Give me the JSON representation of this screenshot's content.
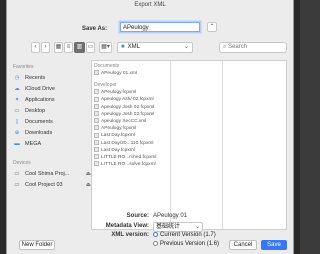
{
  "window": {
    "title": "Export XML"
  },
  "save_as": {
    "label": "Save As:",
    "value": "APeulogy",
    "expand_icon": "chevron-up-icon"
  },
  "toolbar": {
    "location": "XML",
    "search_placeholder": "Search",
    "back_icon": "chevron-left-icon",
    "forward_icon": "chevron-right-icon",
    "icon_view": "grid-icon",
    "list_view": "list-icon",
    "column_view": "columns-icon",
    "gallery_view": "gallery-icon",
    "group_icon": "group-icon"
  },
  "sidebar": {
    "favorites_heading": "Favorites",
    "favorites": [
      {
        "label": "Recents",
        "icon": "clock-icon"
      },
      {
        "label": "iCloud Drive",
        "icon": "cloud-icon"
      },
      {
        "label": "Applications",
        "icon": "applications-icon"
      },
      {
        "label": "Desktop",
        "icon": "desktop-icon"
      },
      {
        "label": "Documents",
        "icon": "document-icon"
      },
      {
        "label": "Downloads",
        "icon": "download-icon"
      },
      {
        "label": "MEGA",
        "icon": "folder-icon"
      }
    ],
    "devices_heading": "Devices",
    "devices": [
      {
        "label": "Cool Shima Proj...",
        "icon": "disk-icon"
      },
      {
        "label": "Cool Project 03",
        "icon": "disk-icon"
      }
    ]
  },
  "browser": {
    "documents_heading": "Documents",
    "documents": [
      "APeulogy 01.xml"
    ],
    "developer_heading": "Developer",
    "developer": [
      "APeulogy.fcpxml",
      "Apeulogy Ash/ 02.fcpxml",
      "Apeulogy Josh 02.fcpxml",
      "Apeulogy Josh 02.fcpxml",
      "Apeulogy XecCC.xml",
      "APeulogy.fcpxml",
      "Last Day.fcpxml",
      "Last Day/20...110.fcpxml",
      "Last Day.fcpxml",
      "LITTLE RO...rched.fcpxml",
      "LITTLE RO...solve.fcpxml"
    ]
  },
  "options": {
    "source_label": "Source:",
    "source_value": "APeulogy 01",
    "metadata_label": "Metadata View:",
    "metadata_value": "基础统计",
    "xml_version_label": "XML version:",
    "version_current": "Current Version (1.7)",
    "version_previous": "Previous Version (1.6)"
  },
  "buttons": {
    "new_folder": "New Folder",
    "cancel": "Cancel",
    "save": "Save"
  },
  "colors": {
    "accent": "#3478f6",
    "dialog_bg": "#ececec"
  }
}
